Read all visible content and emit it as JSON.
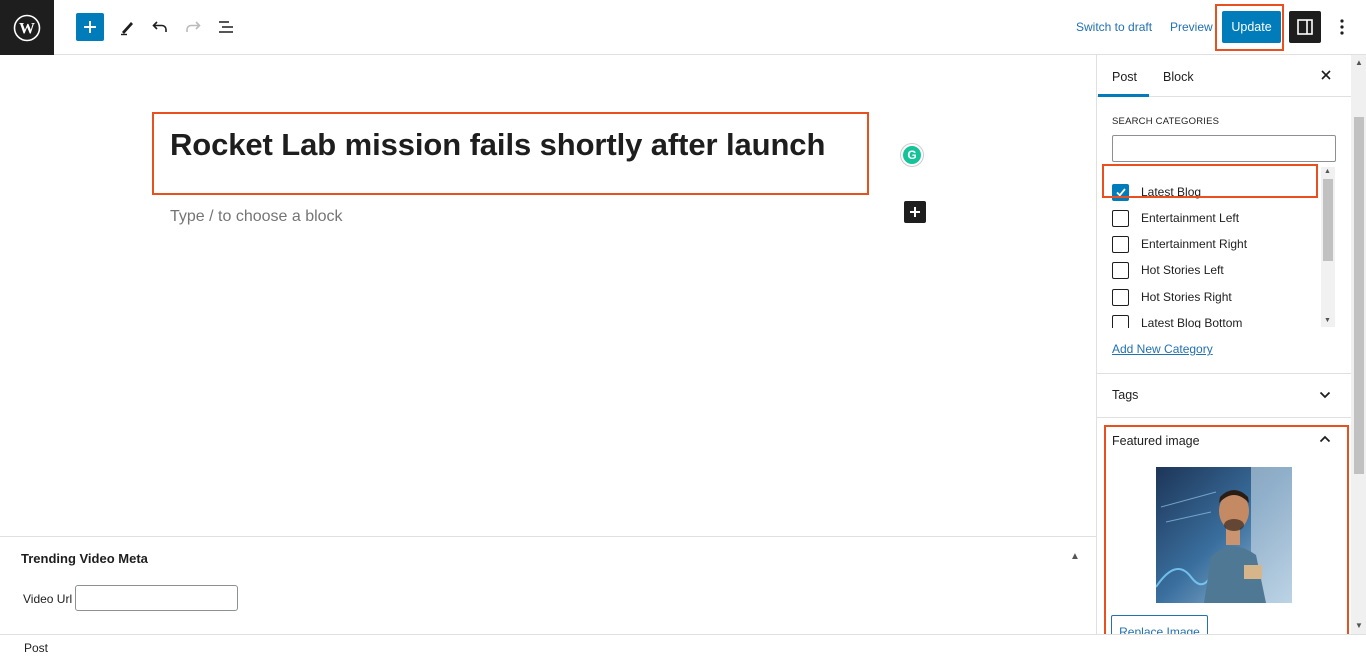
{
  "toolbar": {
    "logo_icon": "wordpress-icon",
    "add_icon": "plus-icon",
    "tools_icon": "pencil-icon",
    "undo_icon": "undo-icon",
    "redo_icon": "redo-icon",
    "outline_icon": "list-view-icon",
    "switch_draft": "Switch to draft",
    "preview": "Preview",
    "update": "Update",
    "settings_icon": "sidebar-toggle-icon",
    "more_icon": "more-vertical-icon"
  },
  "editor": {
    "title": "Rocket Lab mission fails shortly after launch",
    "placeholder": "Type / to choose a block",
    "grammarly_icon": "grammarly-icon",
    "grammarly_letter": "G",
    "inserter_icon": "plus-icon"
  },
  "metabox": {
    "title": "Trending Video Meta",
    "video_url_label": "Video Url",
    "video_url_value": ""
  },
  "footer": {
    "breadcrumb": "Post"
  },
  "sidebar": {
    "tabs": [
      {
        "label": "Post",
        "active": true
      },
      {
        "label": "Block",
        "active": false
      }
    ],
    "close_icon": "close-icon",
    "categories": {
      "heading": "SEARCH CATEGORIES",
      "search_value": "",
      "items": [
        {
          "label": "Latest Blog",
          "checked": true
        },
        {
          "label": "Entertainment Left",
          "checked": false
        },
        {
          "label": "Entertainment Right",
          "checked": false
        },
        {
          "label": "Hot Stories Left",
          "checked": false
        },
        {
          "label": "Hot Stories Right",
          "checked": false
        },
        {
          "label": "Latest Blog Bottom",
          "checked": false
        }
      ],
      "add_new": "Add New Category"
    },
    "tags": {
      "title": "Tags",
      "expanded": false
    },
    "featured_image": {
      "title": "Featured image",
      "expanded": true,
      "replace_label": "Replace Image"
    }
  },
  "colors": {
    "accent": "#007cba",
    "highlight": "#e8501f",
    "dark": "#1e1e1e"
  }
}
